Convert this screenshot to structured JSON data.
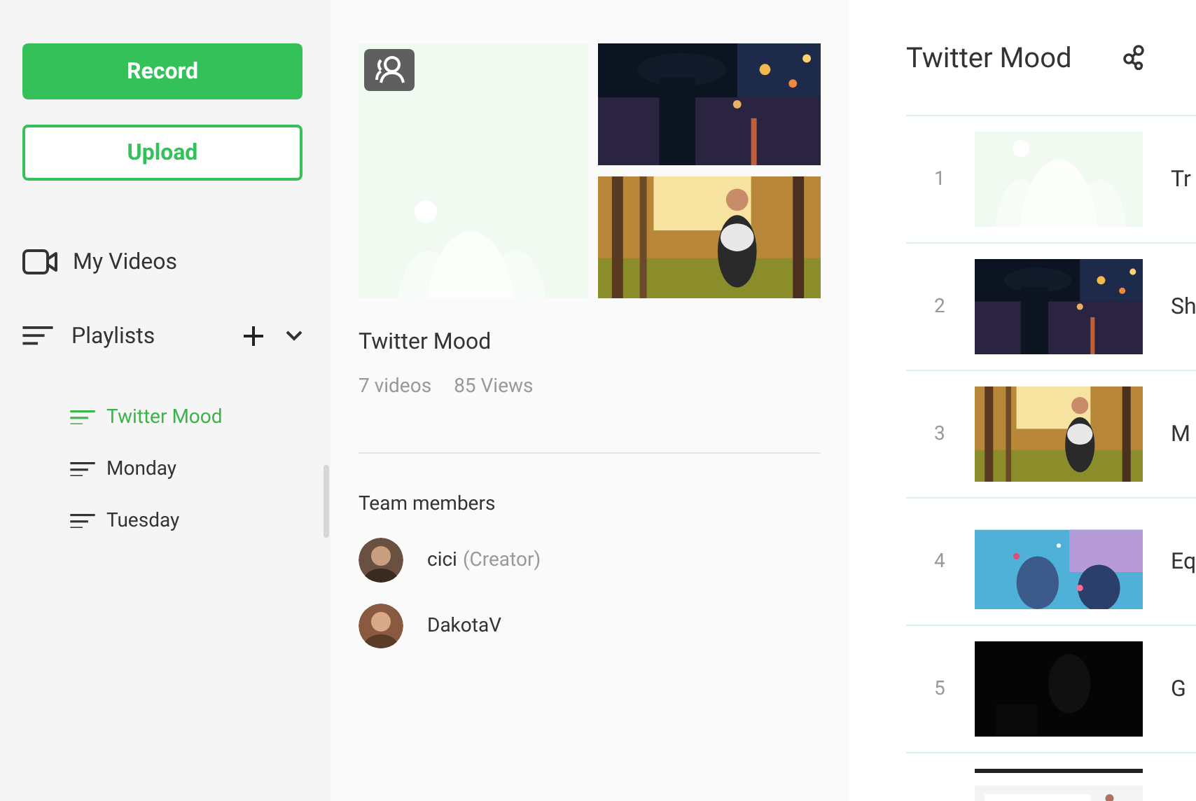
{
  "sidebar": {
    "record_button": "Record",
    "upload_button": "Upload",
    "my_videos": "My Videos",
    "playlists_header": "Playlists",
    "expanded": true,
    "playlists": [
      {
        "name": "Twitter Mood",
        "selected": true
      },
      {
        "name": "Monday",
        "selected": false
      },
      {
        "name": "Tuesday",
        "selected": false
      }
    ]
  },
  "playlist": {
    "title": "Twitter Mood",
    "video_count": "7 videos",
    "views": "85 Views",
    "team_heading": "Team members",
    "cover": [
      {
        "kind": "placeholder"
      },
      {
        "kind": "picture"
      },
      {
        "kind": "picture"
      }
    ],
    "members": [
      {
        "name": "cici",
        "role": "(Creator)"
      },
      {
        "name": "DakotaV"
      }
    ]
  },
  "detail": {
    "title": "Twitter Mood",
    "videos": [
      {
        "number": "1",
        "title": "Tr",
        "kind": "placeholder"
      },
      {
        "number": "2",
        "title": "Sh",
        "kind": "picture"
      },
      {
        "number": "3",
        "title": "M",
        "kind": "picture"
      },
      {
        "number": "4",
        "title": "Eq",
        "kind": "picture"
      },
      {
        "number": "5",
        "title": "G",
        "kind": "picture"
      },
      {
        "kind": "picture"
      }
    ]
  }
}
